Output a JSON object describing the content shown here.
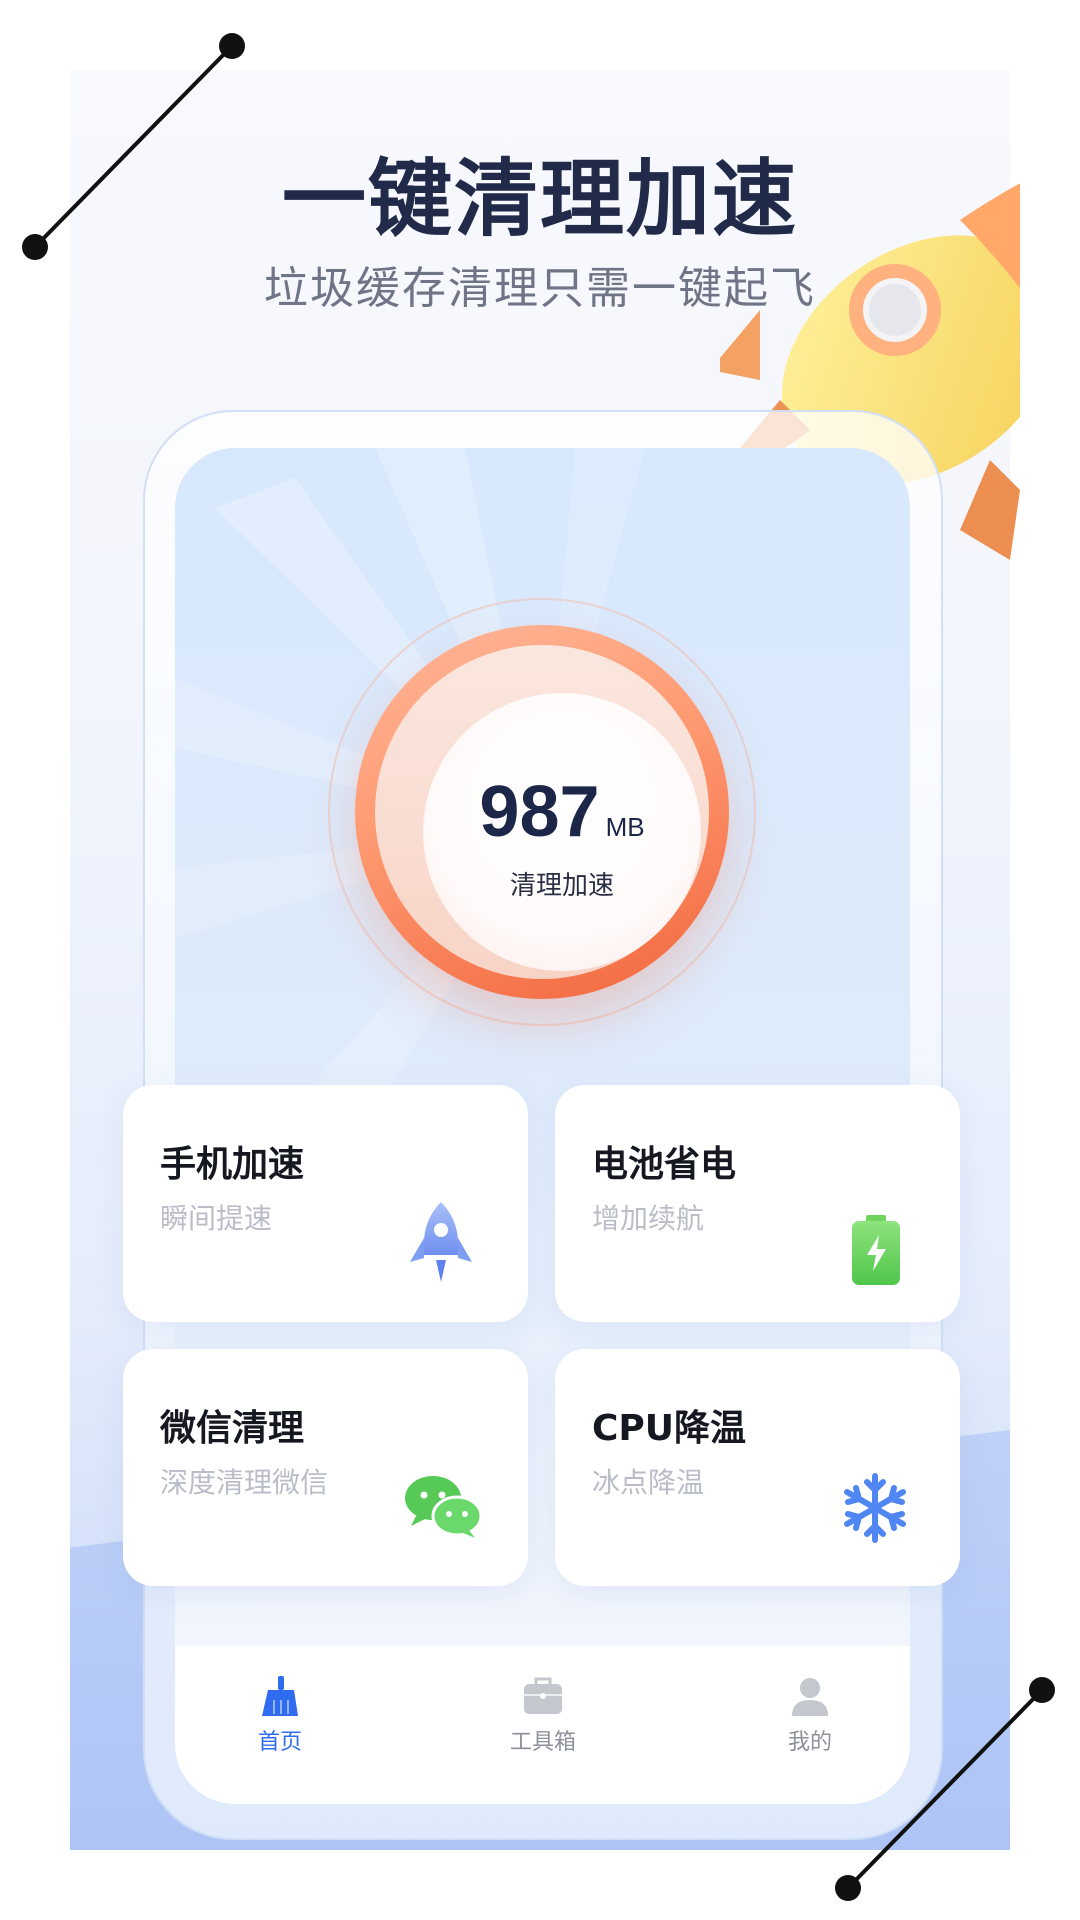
{
  "header": {
    "title": "一键清理加速",
    "subtitle": "垃圾缓存清理只需一键起飞"
  },
  "gauge": {
    "value": "987",
    "unit": "MB",
    "label": "清理加速"
  },
  "features": [
    {
      "title": "手机加速",
      "subtitle": "瞬间提速",
      "icon": "rocket-icon"
    },
    {
      "title": "电池省电",
      "subtitle": "增加续航",
      "icon": "battery-icon"
    },
    {
      "title": "微信清理",
      "subtitle": "深度清理微信",
      "icon": "wechat-icon"
    },
    {
      "title": "CPU降温",
      "subtitle": "冰点降温",
      "icon": "snowflake-icon"
    }
  ],
  "tabbar": {
    "active_tab": "首页",
    "tabs": [
      {
        "label": "首页",
        "icon": "broom-icon"
      },
      {
        "label": "工具箱",
        "icon": "toolbox-icon"
      },
      {
        "label": "我的",
        "icon": "user-icon"
      }
    ]
  },
  "colors": {
    "accent_blue": "#2f6cf0",
    "ring_orange": "#f2663c",
    "title_navy": "#222a4a"
  }
}
